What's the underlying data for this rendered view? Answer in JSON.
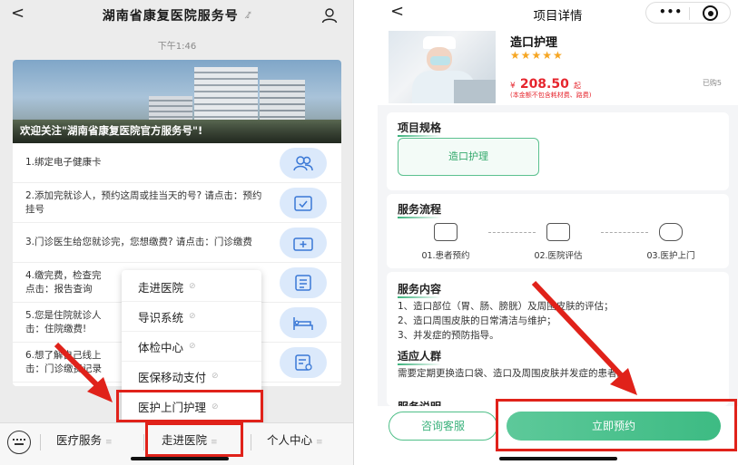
{
  "left": {
    "header": {
      "back": "<",
      "title": "湖南省康复医院服务号",
      "mute": "♪̸"
    },
    "time": "下午1:46",
    "banner_text": "欢迎关注\"湖南省康复医院官方服务号\"!",
    "menu": [
      "1.绑定电子健康卡",
      "2.添加完就诊人，预约这周或挂当天的号? 请点击：预约挂号",
      "3.门诊医生给您就诊完，您想缴费? 请点击：门诊缴费",
      "4.缴完费，检查完",
      "点击：报告查询",
      "5.您是住院就诊人",
      "击：住院缴费!",
      "6.想了解自己线上",
      "击：门诊缴费记录"
    ],
    "popup": [
      "走进医院",
      "导识系统",
      "体检中心",
      "医保移动支付",
      "医护上门护理"
    ],
    "bottom": {
      "tab1": "医疗服务",
      "tab2": "走进医院",
      "tab3": "个人中心"
    }
  },
  "right": {
    "header": {
      "back": "<",
      "title": "项目详情",
      "dots": "•••"
    },
    "product": {
      "name": "造口护理",
      "stars": "★★★★★",
      "currency": "¥",
      "price": "208.50",
      "price_suffix": "起",
      "price_note": "(本金额不包含耗材费、路费)",
      "sold": "已购5"
    },
    "spec": {
      "title": "项目规格",
      "chip": "造口护理"
    },
    "flow": {
      "title": "服务流程",
      "steps": [
        "01.患者预约",
        "02.医院评估",
        "03.医护上门"
      ]
    },
    "content": {
      "title": "服务内容",
      "lines": [
        "1、造口部位（胃、肠、膀胱）及周围皮肤的评估；",
        "2、造口周围皮肤的日常清洁与维护；",
        "3、并发症的预防指导。"
      ],
      "audience_title": "适应人群",
      "audience": "需要定期更换造口袋、造口及周围皮肤并发症的患者。",
      "next_title": "服务说明"
    },
    "bottom": {
      "consult": "咨询客服",
      "book": "立即预约"
    }
  },
  "colors": {
    "accent_green": "#3bb27c",
    "highlight_red": "#e0221a",
    "price_red": "#e6262e"
  }
}
